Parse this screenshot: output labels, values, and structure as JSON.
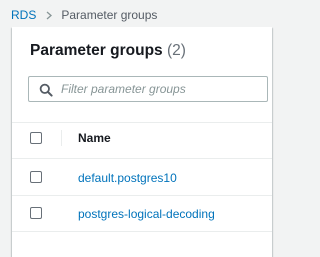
{
  "breadcrumb": {
    "root": "RDS",
    "current": "Parameter groups"
  },
  "panel": {
    "title": "Parameter groups",
    "count": "(2)"
  },
  "search": {
    "placeholder": "Filter parameter groups",
    "value": ""
  },
  "table": {
    "columns": [
      "Name"
    ],
    "rows": [
      {
        "name": "default.postgres10"
      },
      {
        "name": "postgres-logical-decoding"
      }
    ]
  },
  "colors": {
    "link": "#0073bb",
    "text": "#16191f",
    "muted": "#687078",
    "background": "#f2f3f3"
  }
}
